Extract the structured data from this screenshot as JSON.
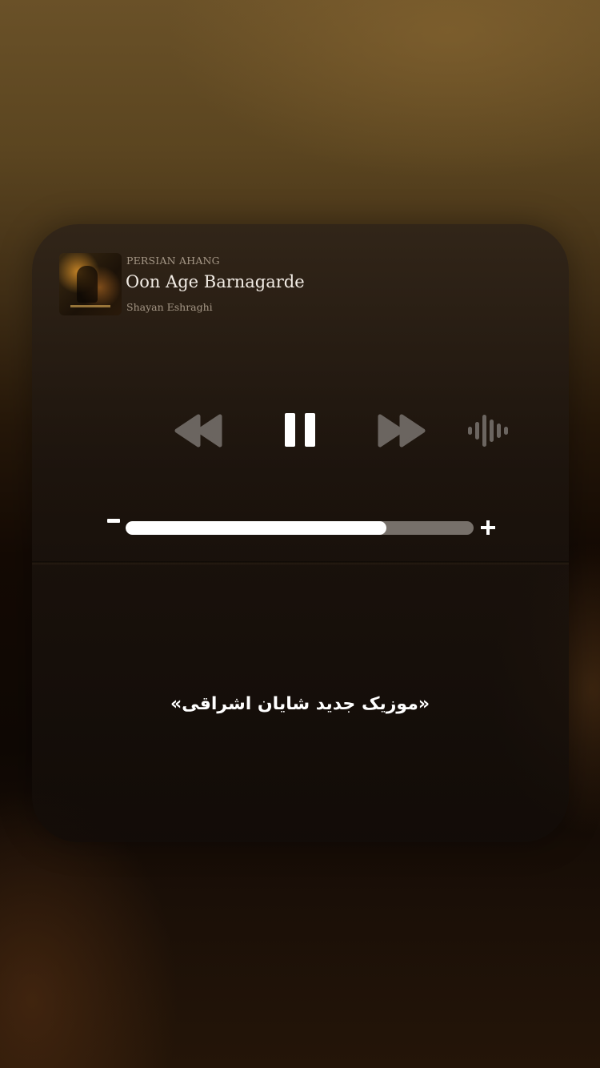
{
  "player": {
    "source_label": "PERSIAN AHANG",
    "track_title": "Oon Age Barnagarde",
    "artist": "Shayan Eshraghi",
    "is_playing": true,
    "volume_level": 0.75
  },
  "controls": {
    "rewind_icon": "rewind-icon",
    "pause_icon": "pause-icon",
    "forward_icon": "fast-forward-icon",
    "waveform_icon": "waveform-icon",
    "volume_minus_icon": "minus-icon",
    "volume_plus_icon": "plus-icon"
  },
  "caption": "«موزیک جدید شایان اشراقی»",
  "colors": {
    "control_gray": "#6b6560",
    "track_bg": "#77706a",
    "track_fill": "#ffffff"
  }
}
